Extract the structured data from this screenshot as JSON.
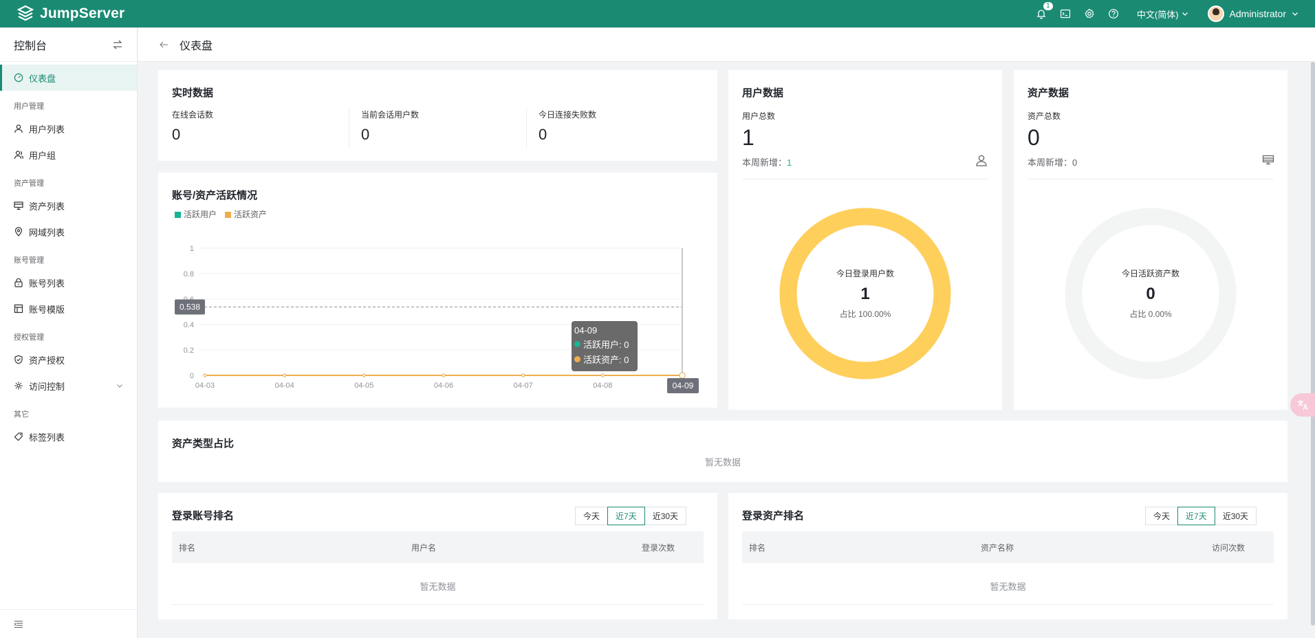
{
  "topbar": {
    "brand": "JumpServer",
    "notification_count": "1",
    "language": "中文(简体)",
    "username": "Administrator"
  },
  "sidebar": {
    "title": "控制台",
    "items": [
      {
        "label": "仪表盘",
        "type": "item",
        "icon": "dashboard-icon",
        "active": true
      },
      {
        "label": "用户管理",
        "type": "group"
      },
      {
        "label": "用户列表",
        "type": "item",
        "icon": "user-icon"
      },
      {
        "label": "用户组",
        "type": "item",
        "icon": "user-group-icon"
      },
      {
        "label": "资产管理",
        "type": "group"
      },
      {
        "label": "资产列表",
        "type": "item",
        "icon": "monitor-icon"
      },
      {
        "label": "网域列表",
        "type": "item",
        "icon": "location-icon"
      },
      {
        "label": "账号管理",
        "type": "group"
      },
      {
        "label": "账号列表",
        "type": "item",
        "icon": "lock-icon"
      },
      {
        "label": "账号模版",
        "type": "item",
        "icon": "template-icon"
      },
      {
        "label": "授权管理",
        "type": "group"
      },
      {
        "label": "资产授权",
        "type": "item",
        "icon": "shield-icon"
      },
      {
        "label": "访问控制",
        "type": "item",
        "icon": "access-control-icon",
        "expandable": true
      },
      {
        "label": "其它",
        "type": "group"
      },
      {
        "label": "标签列表",
        "type": "item",
        "icon": "tag-icon"
      }
    ]
  },
  "page": {
    "title": "仪表盘"
  },
  "realtime": {
    "title": "实时数据",
    "stats": [
      {
        "label": "在线会话数",
        "value": "0"
      },
      {
        "label": "当前会话用户数",
        "value": "0"
      },
      {
        "label": "今日连接失败数",
        "value": "0"
      }
    ]
  },
  "activity": {
    "title": "账号/资产活跃情况",
    "legend": [
      {
        "label": "活跃用户",
        "color": "#1ab394"
      },
      {
        "label": "活跃资产",
        "color": "#f0ad4e"
      }
    ],
    "cursor_value": "0.538",
    "tooltip": {
      "date": "04-09",
      "line1": "活跃用户: 0",
      "line2": "活跃资产: 0"
    },
    "highlight_x": "04-09"
  },
  "chart_data": {
    "type": "line",
    "title": "账号/资产活跃情况",
    "x": [
      "04-03",
      "04-04",
      "04-05",
      "04-06",
      "04-07",
      "04-08",
      "04-09"
    ],
    "y_ticks": [
      "0",
      "0.2",
      "0.4",
      "0.6",
      "0.8",
      "1"
    ],
    "ylim": [
      0,
      1
    ],
    "series": [
      {
        "name": "活跃用户",
        "values": [
          0,
          0,
          0,
          0,
          0,
          0,
          0
        ],
        "color": "#1ab394"
      },
      {
        "name": "活跃资产",
        "values": [
          0,
          0,
          0,
          0,
          0,
          0,
          0
        ],
        "color": "#f0ad4e"
      }
    ],
    "legend_position": "top-left",
    "grid": true
  },
  "user_data": {
    "title": "用户数据",
    "total_label": "用户总数",
    "total_value": "1",
    "week_label": "本周新增：",
    "week_value": "1",
    "ring_label": "今日登录用户数",
    "ring_value": "1",
    "ring_ratio": "占比 100.00%",
    "ring_fraction": 1.0,
    "ring_color": "#ffcf5c"
  },
  "asset_data": {
    "title": "资产数据",
    "total_label": "资产总数",
    "total_value": "0",
    "week_label": "本周新增：",
    "week_value": "0",
    "ring_label": "今日活跃资产数",
    "ring_value": "0",
    "ring_ratio": "占比 0.00%",
    "ring_fraction": 0.0,
    "ring_color": "#f3f5f4"
  },
  "asset_type": {
    "title": "资产类型占比",
    "empty": "暂无数据"
  },
  "login_account_rank": {
    "title": "登录账号排名",
    "tabs": [
      "今天",
      "近7天",
      "近30天"
    ],
    "active_tab": "近7天",
    "columns": [
      "排名",
      "用户名",
      "登录次数"
    ],
    "empty": "暂无数据"
  },
  "login_asset_rank": {
    "title": "登录资产排名",
    "tabs": [
      "今天",
      "近7天",
      "近30天"
    ],
    "active_tab": "近7天",
    "columns": [
      "排名",
      "资产名称",
      "访问次数"
    ],
    "empty": "暂无数据"
  },
  "colors": {
    "primary": "#1a8a73",
    "accent_green": "#1ab394",
    "accent_orange": "#f0ad4e"
  }
}
